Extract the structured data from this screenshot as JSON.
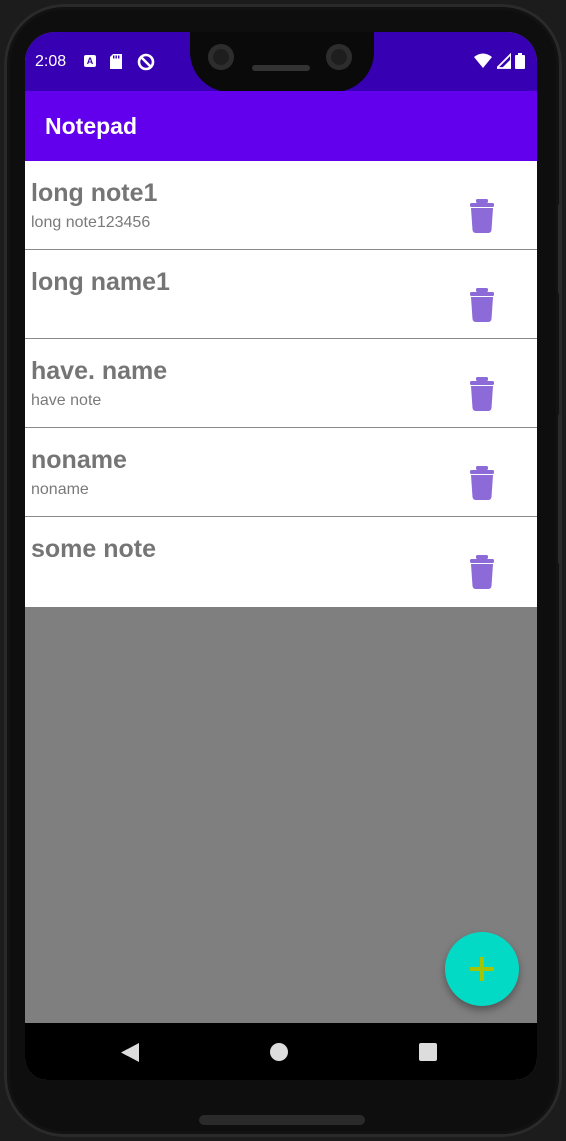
{
  "status_bar": {
    "time": "2:08",
    "left_icons": [
      "a-icon",
      "sd-card-icon",
      "data-saver-icon"
    ],
    "right_icons": [
      "wifi-icon",
      "signal-icon",
      "battery-icon"
    ],
    "notification_letter": "A"
  },
  "app_bar": {
    "title": "Notepad"
  },
  "notes": [
    {
      "name": "long note1",
      "text": "long note123456"
    },
    {
      "name": "long name1",
      "text": ""
    },
    {
      "name": "have. name",
      "text": "have note"
    },
    {
      "name": "noname",
      "text": "noname"
    },
    {
      "name": "some note",
      "text": ""
    }
  ],
  "fab": {
    "icon": "plus-icon"
  },
  "nav_bar": {
    "icons": [
      "back-icon",
      "home-icon",
      "recents-icon"
    ]
  },
  "colors": {
    "status_bar": "#3700b3",
    "app_bar": "#6200ee",
    "fab": "#03dac5",
    "fab_plus": "#a6c400",
    "delete_icon": "#8c6bd8",
    "list_background": "#7f7f7f"
  }
}
